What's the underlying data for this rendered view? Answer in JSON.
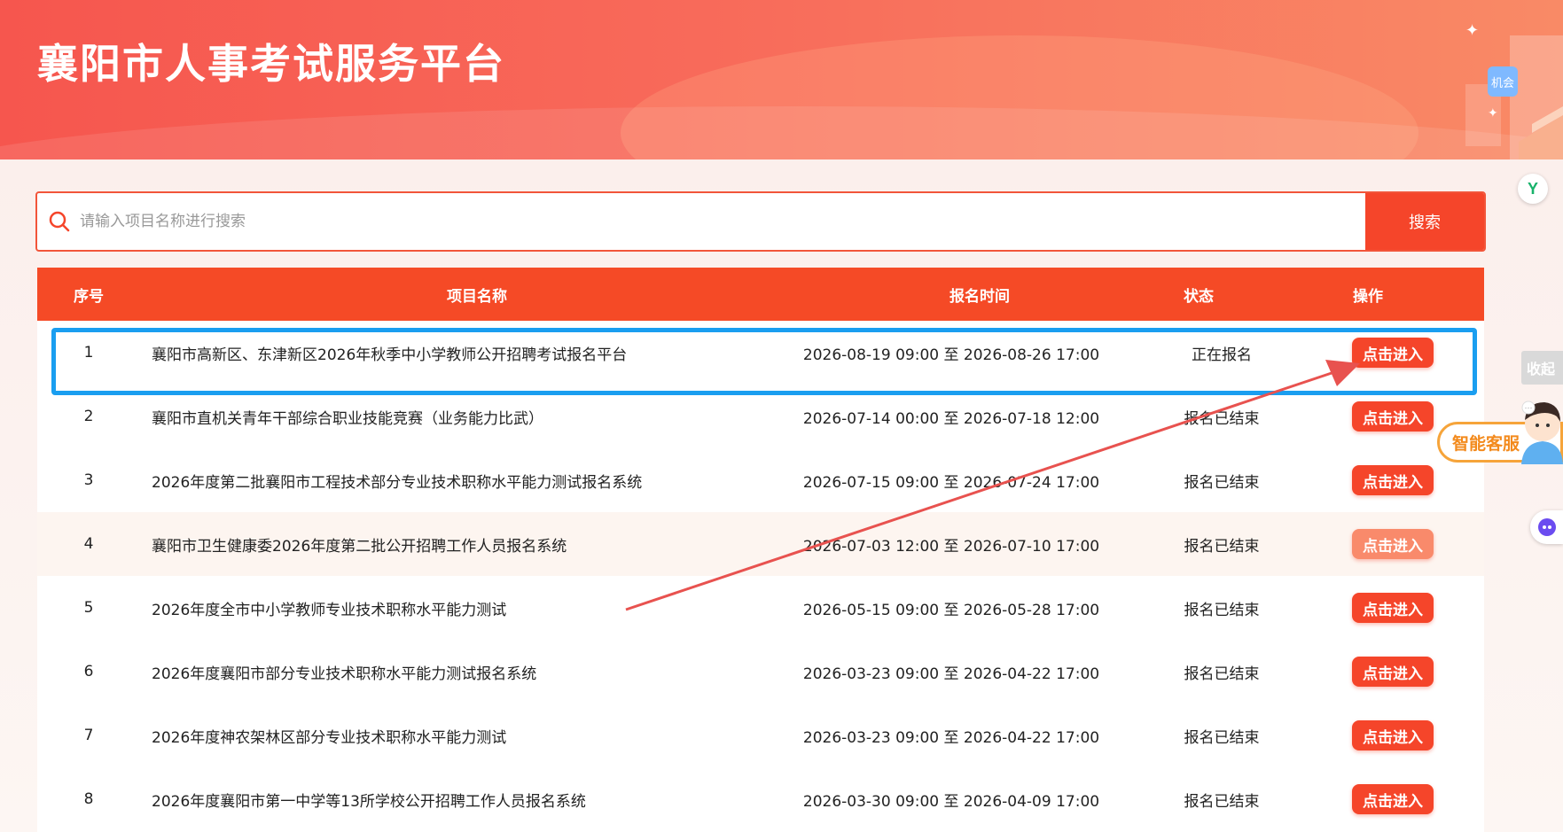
{
  "header": {
    "title": "襄阳市人事考试服务平台"
  },
  "search": {
    "placeholder": "请输入项目名称进行搜索",
    "button_label": "搜索"
  },
  "table": {
    "columns": [
      "序号",
      "项目名称",
      "报名时间",
      "状态",
      "操作"
    ],
    "rows": [
      {
        "no": "1",
        "name": "襄阳市高新区、东津新区2026年秋季中小学教师公开招聘考试报名平台",
        "time": "2026-08-19 09:00 至 2026-08-26 17:00",
        "status": "正在报名",
        "action": "点击进入"
      },
      {
        "no": "2",
        "name": "襄阳市直机关青年干部综合职业技能竞赛（业务能力比武）",
        "time": "2026-07-14 00:00 至 2026-07-18 12:00",
        "status": "报名已结束",
        "action": "点击进入"
      },
      {
        "no": "3",
        "name": "2026年度第二批襄阳市工程技术部分专业技术职称水平能力测试报名系统",
        "time": "2026-07-15 09:00 至 2026-07-24 17:00",
        "status": "报名已结束",
        "action": "点击进入"
      },
      {
        "no": "4",
        "name": "襄阳市卫生健康委2026年度第二批公开招聘工作人员报名系统",
        "time": "2026-07-03 12:00 至 2026-07-10 17:00",
        "status": "报名已结束",
        "action": "点击进入"
      },
      {
        "no": "5",
        "name": "2026年度全市中小学教师专业技术职称水平能力测试",
        "time": "2026-05-15 09:00 至 2026-05-28 17:00",
        "status": "报名已结束",
        "action": "点击进入"
      },
      {
        "no": "6",
        "name": "2026年度襄阳市部分专业技术职称水平能力测试报名系统",
        "time": "2026-03-23 09:00 至 2026-04-22 17:00",
        "status": "报名已结束",
        "action": "点击进入"
      },
      {
        "no": "7",
        "name": "2026年度神农架林区部分专业技术职称水平能力测试",
        "time": "2026-03-23 09:00 至 2026-04-22 17:00",
        "status": "报名已结束",
        "action": "点击进入"
      },
      {
        "no": "8",
        "name": "2026年度襄阳市第一中学等13所学校公开招聘工作人员报名系统",
        "time": "2026-03-30 09:00 至 2026-04-09 17:00",
        "status": "报名已结束",
        "action": "点击进入"
      }
    ]
  },
  "side": {
    "collapse_label": "收起",
    "service_label": "智能客服",
    "deco_badge": "机会"
  },
  "colors": {
    "brand": "#f5452a",
    "annotation_box": "#1a9ef0",
    "annotation_arrow": "#e8524f"
  }
}
